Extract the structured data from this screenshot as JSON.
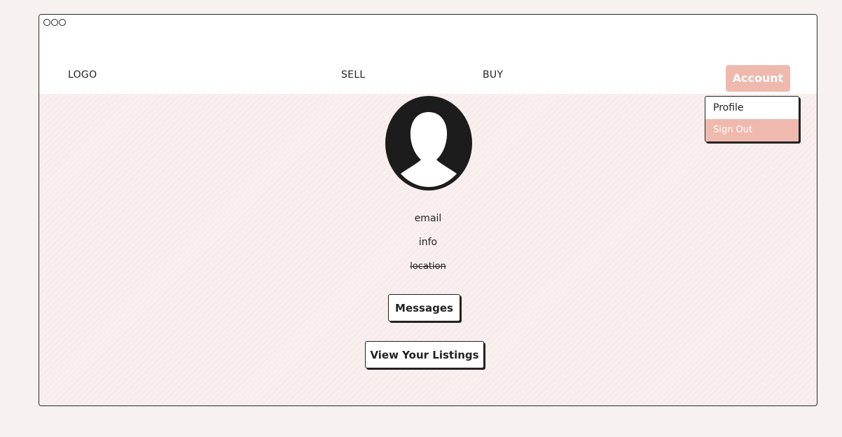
{
  "window": {
    "controls": [
      "circle-icon",
      "circle-icon",
      "circle-icon"
    ]
  },
  "nav": {
    "logo": "LOGO",
    "sell": "SELL",
    "buy": "BUY",
    "account": "Account"
  },
  "dropdown": {
    "items": [
      {
        "label": "Profile",
        "active": false
      },
      {
        "label": "Sign Out",
        "active": true
      }
    ]
  },
  "profile": {
    "avatar_icon": "user-avatar-icon",
    "email": "email",
    "info": "info",
    "location": "location"
  },
  "actions": {
    "messages": "Messages",
    "view_listings": "View Your Listings"
  },
  "colors": {
    "accent": "#efb9ae",
    "background": "#f7f2ef",
    "content_background": "#f8efee",
    "text": "#222222"
  }
}
